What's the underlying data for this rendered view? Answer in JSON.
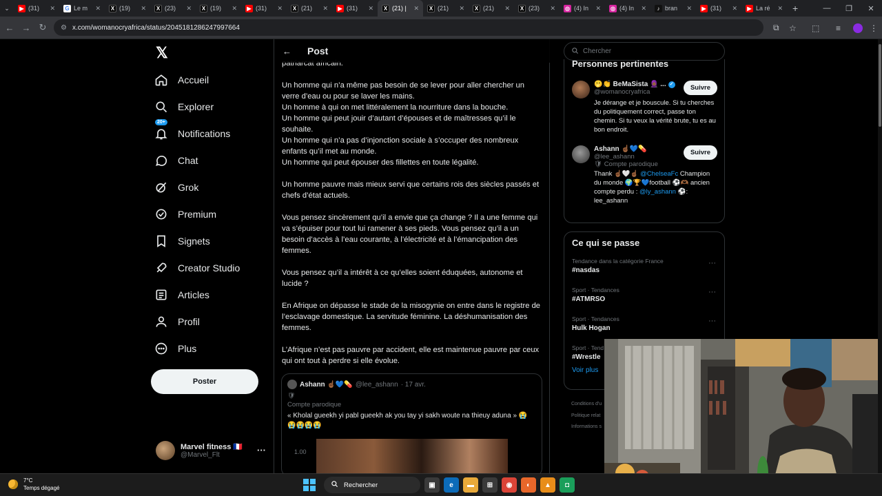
{
  "browser": {
    "tabs": [
      {
        "label": "(31)",
        "favicon": "yt"
      },
      {
        "label": "Le m",
        "favicon": "g"
      },
      {
        "label": "(19)",
        "favicon": "x"
      },
      {
        "label": "(23)",
        "favicon": "x"
      },
      {
        "label": "(19)",
        "favicon": "x"
      },
      {
        "label": "(31)",
        "favicon": "yt"
      },
      {
        "label": "(21)",
        "favicon": "x"
      },
      {
        "label": "(31)",
        "favicon": "yt"
      },
      {
        "label": "(21) |",
        "favicon": "x",
        "active": true
      },
      {
        "label": "(21)",
        "favicon": "x"
      },
      {
        "label": "(21)",
        "favicon": "x"
      },
      {
        "label": "(23)",
        "favicon": "x"
      },
      {
        "label": "(4) In",
        "favicon": "ig"
      },
      {
        "label": "(4) In",
        "favicon": "ig"
      },
      {
        "label": "bran",
        "favicon": "tt"
      },
      {
        "label": "(31)",
        "favicon": "yt"
      },
      {
        "label": "La ré",
        "favicon": "yt"
      }
    ],
    "url": "x.com/womanocryafrica/status/2045181286247997664"
  },
  "sidebar": {
    "items": [
      {
        "label": "Accueil",
        "icon": "home-icon"
      },
      {
        "label": "Explorer",
        "icon": "search-icon"
      },
      {
        "label": "Notifications",
        "icon": "bell-icon",
        "badge": "20+"
      },
      {
        "label": "Chat",
        "icon": "chat-icon"
      },
      {
        "label": "Grok",
        "icon": "grok-icon"
      },
      {
        "label": "Premium",
        "icon": "premium-icon"
      },
      {
        "label": "Signets",
        "icon": "bookmark-icon"
      },
      {
        "label": "Creator Studio",
        "icon": "rocket-icon"
      },
      {
        "label": "Articles",
        "icon": "article-icon"
      },
      {
        "label": "Profil",
        "icon": "person-icon"
      },
      {
        "label": "Plus",
        "icon": "more-circle-icon"
      }
    ],
    "post_button": "Poster",
    "account": {
      "name": "Marvel fitness 🇫🇷",
      "handle": "@Marvel_Flt"
    }
  },
  "main": {
    "header_title": "Post",
    "paragraphs": [
      "patriarcat africain.",
      "Un homme qui n’a même pas besoin de se lever pour aller chercher un verre d’eau ou pour se laver les mains.\nUn homme à qui on met littéralement la nourriture dans la bouche.\nUn homme qui peut jouir d’autant d’épouses et de maîtresses qu’il le souhaite.\nUn homme qui n’a pas d’injonction sociale à s’occuper des nombreux enfants qu’il met au monde.\nUn homme qui peut épouser des fillettes en toute légalité.",
      "Un homme pauvre mais mieux servi que certains rois des siècles passés et chefs d’état actuels.",
      "Vous pensez sincèrement qu’il a envie que ça change ? Il a une femme qui va s’épuiser pour tout lui ramener à ses pieds. Vous pensez qu’il a un besoin d’accès à l’eau courante, à l’électricité et à l’émancipation des femmes.",
      "Vous pensez qu’il a intérêt à ce qu’elles soient éduquées, autonome et lucide ?",
      "En Afrique on dépasse le stade de la misogynie on entre dans le registre de l’esclavage domestique. La servitude féminine. La déshumanisation des femmes.",
      "L’Afrique n’est pas pauvre par accident, elle est maintenue pauvre par ceux qui ont tout à perdre si elle évolue."
    ],
    "quote": {
      "name": "Ashann ☝🏾💙💊",
      "handle": "@lee_ashann",
      "date": "· 17 avr.",
      "emoji": "🛡",
      "label": "Compte parodique",
      "text": "« Kholal gueekh yi pabl gueekh ak you tay yi sakh woute na thieuy aduna » 😭\n😭😭😭😭",
      "video_label": "1.00"
    }
  },
  "right": {
    "search_placeholder": "Chercher",
    "people_title": "Personnes pertinentes",
    "people": [
      {
        "name": "🫢👏 BeMaSista 🧕🏾 ...",
        "handle": "@womanocryafrica",
        "bio": "Je dérange et je bouscule. Si tu cherches du politiquement correct, passe ton chemin. Si tu veux la vérité brute, tu es au bon endroit.",
        "follow": "Suivre"
      },
      {
        "name": "Ashann ☝🏾💙💊",
        "handle": "@lee_ashann",
        "parody": "🛡 Compte parodique",
        "bio_a": "Thank ☝🏾🤍☝🏾 ",
        "bio_link": "@ChelseaFc",
        "bio_b": " Champion du monde 🌍🏆💙football ⚽🫶🏾 ancien compte perdu : ",
        "bio_link2": "@ly_ashann",
        "bio_c": " ⚽: lee_ashann",
        "follow": "Suivre"
      }
    ],
    "trends_title": "Ce qui se passe",
    "trends": [
      {
        "context": "Tendance dans la catégorie France",
        "name": "#nasdas"
      },
      {
        "context": "Sport · Tendances",
        "name": "#ATMRSO"
      },
      {
        "context": "Sport · Tendances",
        "name": "Hulk Hogan"
      },
      {
        "context": "Sport · Tend",
        "name": "#Wrestle"
      }
    ],
    "show_more": "Voir plus",
    "footer": [
      "Conditions d'u",
      "Politique relat",
      "Informations s"
    ]
  },
  "taskbar": {
    "temp": "7°C",
    "weather": "Temps dégagé",
    "search": "Rechercher"
  },
  "colors": {
    "accent": "#1d9bf0",
    "bg": "#000000",
    "border": "#2f3336",
    "muted": "#71767b"
  }
}
